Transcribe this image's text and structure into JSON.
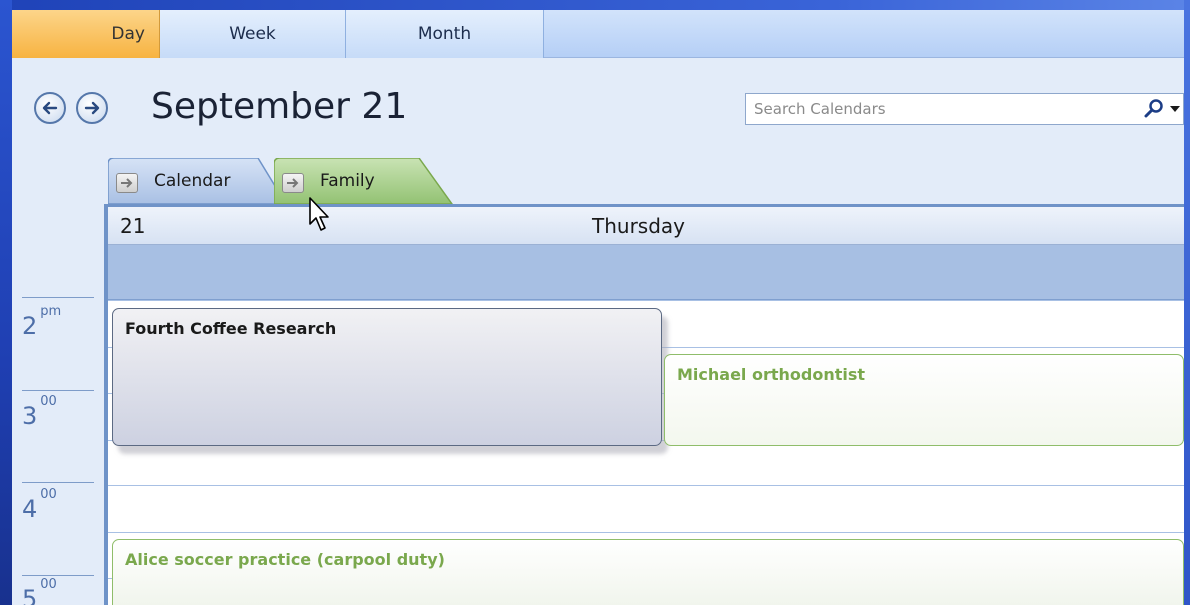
{
  "view_tabs": {
    "day": "Day",
    "week": "Week",
    "month": "Month",
    "active": "Day"
  },
  "header": {
    "date_title": "September 21",
    "prev_icon": "arrow-left-icon",
    "next_icon": "arrow-right-icon"
  },
  "search": {
    "placeholder": "Search Calendars",
    "icon": "magnifier-icon"
  },
  "calendar_tabs": [
    {
      "label": "Calendar",
      "color": "#b9cdeb"
    },
    {
      "label": "Family",
      "color": "#a6cf8c"
    }
  ],
  "day": {
    "number": "21",
    "weekday": "Thursday"
  },
  "times": [
    {
      "hour": "2",
      "suffix": "pm"
    },
    {
      "hour": "3",
      "suffix": "00"
    },
    {
      "hour": "4",
      "suffix": "00"
    },
    {
      "hour": "5",
      "suffix": "00"
    }
  ],
  "appointments": [
    {
      "title": "Fourth Coffee Research",
      "calendar": "Calendar",
      "color": "#cdd1e1"
    },
    {
      "title": "Michael orthodontist",
      "calendar": "Family",
      "color": "#7aa84d"
    },
    {
      "title": "Alice soccer practice (carpool duty)",
      "calendar": "Family",
      "color": "#7aa84d"
    }
  ],
  "colors": {
    "frame_blue": "#1f3fb2",
    "active_tab": "#f7b341",
    "allday_band": "#a7bfe3"
  }
}
